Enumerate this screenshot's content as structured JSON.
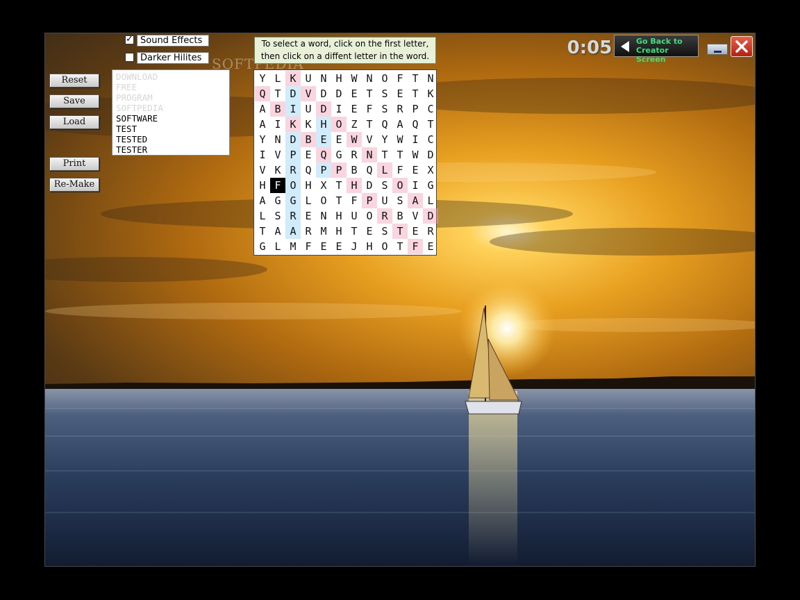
{
  "controls": {
    "sound_effects": {
      "label": "Sound Effects",
      "checked": true
    },
    "darker_hilites": {
      "label": "Darker Hilites",
      "checked": false
    },
    "buttons": {
      "reset": "Reset",
      "save": "Save",
      "load": "Load",
      "print": "Print",
      "remake": "Re-Make"
    }
  },
  "instructions": {
    "line1": "To select a word, click on the first letter,",
    "line2": "then click on a diffent letter in the word."
  },
  "watermark": "SOFTPEDIA",
  "word_list": {
    "found": [
      "DOWNLOAD",
      "FREE",
      "PROGRAM",
      "SOFTPEDIA"
    ],
    "remaining": [
      "SOFTWARE",
      "TEST",
      "TESTED",
      "TESTER"
    ]
  },
  "grid": {
    "rows": [
      "YLKUNHWNOFTN",
      "QTDVDDETSETK",
      "ABIUDIEFSRPC",
      "AIKKHOZTQAQT",
      "YNDBEEWVYWIC",
      "IVPEQGRNTTWD",
      "VKRQPPBQLFEX",
      "HFOHXTHDSOIG",
      "AGGLOTFPUSAL",
      "LSRENHUORBVD",
      "TAARMHTESTER",
      "GLMFEEJHOTFE"
    ],
    "selected_cell": [
      7,
      1
    ],
    "highlight_red": [
      [
        1,
        0
      ],
      [
        2,
        1
      ],
      [
        3,
        2
      ],
      [
        4,
        3
      ],
      [
        5,
        4
      ],
      [
        6,
        5
      ],
      [
        7,
        6
      ],
      [
        8,
        7
      ],
      [
        9,
        8
      ],
      [
        10,
        9
      ],
      [
        11,
        10
      ],
      [
        0,
        2
      ],
      [
        1,
        3
      ],
      [
        2,
        4
      ],
      [
        3,
        5
      ],
      [
        4,
        6
      ],
      [
        5,
        7
      ],
      [
        6,
        8
      ],
      [
        7,
        9
      ],
      [
        8,
        10
      ],
      [
        9,
        11
      ]
    ],
    "highlight_blue": [
      [
        1,
        2
      ],
      [
        2,
        2
      ],
      [
        3,
        2
      ],
      [
        4,
        2
      ],
      [
        5,
        2
      ],
      [
        6,
        2
      ],
      [
        7,
        2
      ],
      [
        8,
        2
      ],
      [
        9,
        2
      ],
      [
        10,
        2
      ],
      [
        3,
        4
      ],
      [
        4,
        4
      ],
      [
        5,
        4
      ],
      [
        6,
        4
      ]
    ]
  },
  "timer": "0:05",
  "back_button": {
    "line1": "Go Back to",
    "line2": "Creator Screen",
    "icon": "arrow-left-icon"
  },
  "window_buttons": {
    "minimize_icon": "minimize-icon",
    "close_icon": "close-icon"
  },
  "colors": {
    "back_label": "#3ee07a",
    "close_red": "#c8281a",
    "selected_cell": "#000000",
    "found_word": "#d6d6d6"
  }
}
